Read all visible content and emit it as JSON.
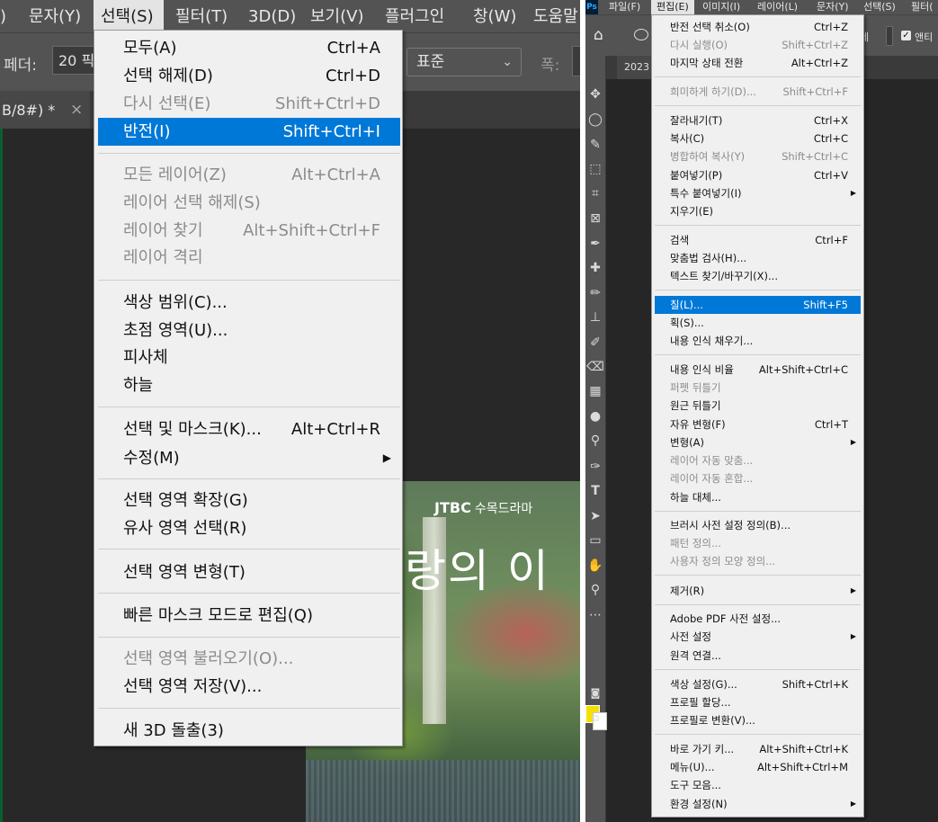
{
  "left": {
    "menubar": [
      {
        "label": ")"
      },
      {
        "label": "문자(Y)"
      },
      {
        "label": "선택(S)"
      },
      {
        "label": "필터(T)"
      },
      {
        "label": "3D(D)"
      },
      {
        "label": "보기(V)"
      },
      {
        "label": "플러그인"
      },
      {
        "label": "창(W)"
      },
      {
        "label": "도움말"
      }
    ],
    "options": {
      "feather_label": "페더:",
      "feather_value": "20 픽",
      "style_value": "표준",
      "width_label": "폭:"
    },
    "doc_tab": {
      "title": "B/8#) *",
      "close": "×"
    },
    "image": {
      "logo": "JTBC",
      "logo_sub": "수목드라마",
      "title_partial": "랑의 이"
    },
    "select_menu": {
      "items": [
        {
          "label": "모두(A)",
          "shortcut": "Ctrl+A"
        },
        {
          "label": "선택 해제(D)",
          "shortcut": "Ctrl+D"
        },
        {
          "label": "다시 선택(E)",
          "shortcut": "Shift+Ctrl+D"
        },
        {
          "label": "반전(I)",
          "shortcut": "Shift+Ctrl+I"
        },
        {
          "label": "모든 레이어(Z)",
          "shortcut": "Alt+Ctrl+A"
        },
        {
          "label": "레이어 선택 해제(S)",
          "shortcut": ""
        },
        {
          "label": "레이어 찾기",
          "shortcut": "Alt+Shift+Ctrl+F"
        },
        {
          "label": "레이어 격리",
          "shortcut": ""
        },
        {
          "label": "색상 범위(C)...",
          "shortcut": ""
        },
        {
          "label": "초점 영역(U)...",
          "shortcut": ""
        },
        {
          "label": "피사체",
          "shortcut": ""
        },
        {
          "label": "하늘",
          "shortcut": ""
        },
        {
          "label": "선택 및 마스크(K)...",
          "shortcut": "Alt+Ctrl+R"
        },
        {
          "label": "수정(M)",
          "shortcut": "",
          "arrow": "▶"
        },
        {
          "label": "선택 영역 확장(G)",
          "shortcut": ""
        },
        {
          "label": "유사 영역 선택(R)",
          "shortcut": ""
        },
        {
          "label": "선택 영역 변형(T)",
          "shortcut": ""
        },
        {
          "label": "빠른 마스크 모드로 편집(Q)",
          "shortcut": ""
        },
        {
          "label": "선택 영역 불러오기(O)...",
          "shortcut": ""
        },
        {
          "label": "선택 영역 저장(V)...",
          "shortcut": ""
        },
        {
          "label": "새 3D 돌출(3)",
          "shortcut": ""
        }
      ]
    }
  },
  "right": {
    "app_logo": "Ps",
    "menubar": [
      {
        "label": "파일(F)"
      },
      {
        "label": "편집(E)"
      },
      {
        "label": "이미지(I)"
      },
      {
        "label": "레이어(L)"
      },
      {
        "label": "문자(Y)"
      },
      {
        "label": "선택(S)"
      },
      {
        "label": "필터("
      }
    ],
    "options": {
      "trail_label": "세",
      "antialias_label": "앤티",
      "check": "✓"
    },
    "doc_tab": {
      "title": "2023"
    },
    "edit_menu": {
      "items": [
        {
          "label": "반전 선택 취소(O)",
          "shortcut": "Ctrl+Z"
        },
        {
          "label": "다시 실행(O)",
          "shortcut": "Shift+Ctrl+Z"
        },
        {
          "label": "마지막 상태 전환",
          "shortcut": "Alt+Ctrl+Z"
        },
        {
          "label": "희미하게 하기(D)...",
          "shortcut": "Shift+Ctrl+F"
        },
        {
          "label": "잘라내기(T)",
          "shortcut": "Ctrl+X"
        },
        {
          "label": "복사(C)",
          "shortcut": "Ctrl+C"
        },
        {
          "label": "병합하여 복사(Y)",
          "shortcut": "Shift+Ctrl+C"
        },
        {
          "label": "붙여넣기(P)",
          "shortcut": "Ctrl+V"
        },
        {
          "label": "특수 붙여넣기(I)",
          "shortcut": "",
          "arrow": "▶"
        },
        {
          "label": "지우기(E)",
          "shortcut": ""
        },
        {
          "label": "검색",
          "shortcut": "Ctrl+F"
        },
        {
          "label": "맞춤법 검사(H)...",
          "shortcut": ""
        },
        {
          "label": "텍스트 찾기/바꾸기(X)...",
          "shortcut": ""
        },
        {
          "label": "칠(L)...",
          "shortcut": "Shift+F5"
        },
        {
          "label": "획(S)...",
          "shortcut": ""
        },
        {
          "label": "내용 인식 채우기...",
          "shortcut": ""
        },
        {
          "label": "내용 인식 비율",
          "shortcut": "Alt+Shift+Ctrl+C"
        },
        {
          "label": "퍼펫 뒤틀기",
          "shortcut": ""
        },
        {
          "label": "원근 뒤틀기",
          "shortcut": ""
        },
        {
          "label": "자유 변형(F)",
          "shortcut": "Ctrl+T"
        },
        {
          "label": "변형(A)",
          "shortcut": "",
          "arrow": "▶"
        },
        {
          "label": "레이어 자동 맞춤...",
          "shortcut": ""
        },
        {
          "label": "레이어 자동 혼합...",
          "shortcut": ""
        },
        {
          "label": "하늘 대체...",
          "shortcut": ""
        },
        {
          "label": "브러시 사전 설정 정의(B)...",
          "shortcut": ""
        },
        {
          "label": "패턴 정의...",
          "shortcut": ""
        },
        {
          "label": "사용자 정의 모양 정의...",
          "shortcut": ""
        },
        {
          "label": "제거(R)",
          "shortcut": "",
          "arrow": "▶"
        },
        {
          "label": "Adobe PDF 사전 설정...",
          "shortcut": ""
        },
        {
          "label": "사전 설정",
          "shortcut": "",
          "arrow": "▶"
        },
        {
          "label": "원격 연결...",
          "shortcut": ""
        },
        {
          "label": "색상 설정(G)...",
          "shortcut": "Shift+Ctrl+K"
        },
        {
          "label": "프로필 할당...",
          "shortcut": ""
        },
        {
          "label": "프로필로 변환(V)...",
          "shortcut": ""
        },
        {
          "label": "바로 가기 키...",
          "shortcut": "Alt+Shift+Ctrl+K"
        },
        {
          "label": "메뉴(U)...",
          "shortcut": "Alt+Shift+Ctrl+M"
        },
        {
          "label": "도구 모음...",
          "shortcut": ""
        },
        {
          "label": "환경 설정(N)",
          "shortcut": "",
          "arrow": "▶"
        }
      ]
    },
    "tools": [
      {
        "icon": "move-icon",
        "glyph": "✥"
      },
      {
        "icon": "lasso-icon",
        "glyph": "◯"
      },
      {
        "icon": "quick-select-icon",
        "glyph": "✎"
      },
      {
        "icon": "object-select-icon",
        "glyph": "⬚"
      },
      {
        "icon": "crop-icon",
        "glyph": "⌗"
      },
      {
        "icon": "frame-icon",
        "glyph": "⊠"
      },
      {
        "icon": "eyedropper-icon",
        "glyph": "✒"
      },
      {
        "icon": "healing-icon",
        "glyph": "✚"
      },
      {
        "icon": "brush-icon",
        "glyph": "✏"
      },
      {
        "icon": "stamp-icon",
        "glyph": "⊥"
      },
      {
        "icon": "history-brush-icon",
        "glyph": "✐"
      },
      {
        "icon": "eraser-icon",
        "glyph": "⌫"
      },
      {
        "icon": "gradient-icon",
        "glyph": "▦"
      },
      {
        "icon": "blur-icon",
        "glyph": "●"
      },
      {
        "icon": "dodge-icon",
        "glyph": "⚲"
      },
      {
        "icon": "pen-icon",
        "glyph": "✑"
      },
      {
        "icon": "type-icon",
        "glyph": "T"
      },
      {
        "icon": "path-select-icon",
        "glyph": "➤"
      },
      {
        "icon": "rectangle-icon",
        "glyph": "▭"
      },
      {
        "icon": "hand-icon",
        "glyph": "✋"
      },
      {
        "icon": "zoom-icon",
        "glyph": "⚲"
      },
      {
        "icon": "more-tools-icon",
        "glyph": "⋯"
      }
    ]
  }
}
